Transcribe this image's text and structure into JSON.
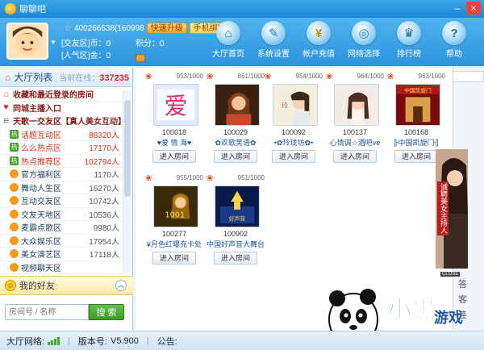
{
  "window": {
    "title": "聊聊吧"
  },
  "user": {
    "id_line": "400266638(160998",
    "quick_upgrade": "快速升级",
    "bind_phone": "手机绑定",
    "coin_label": "[交友区]币：",
    "coin_value": "0",
    "points_label": "积分：",
    "points_value": "0",
    "gold_label": "[人气区]金：",
    "gold_value": "0"
  },
  "nav": [
    {
      "label": "大厅首页",
      "icon": "home-icon"
    },
    {
      "label": "系统设置",
      "icon": "wrench-icon"
    },
    {
      "label": "帐户充值",
      "icon": "money-bag-icon"
    },
    {
      "label": "网络选择",
      "icon": "globe-icon"
    },
    {
      "label": "排行榜",
      "icon": "crown-icon"
    },
    {
      "label": "帮助",
      "icon": "help-icon"
    }
  ],
  "lobby": {
    "title": "大厅列表",
    "online_label": "当前在线：",
    "online_count": "337235",
    "rooms": [
      {
        "name": "收藏和最近登录的房间",
        "count": "",
        "icon": "home-icon"
      },
      {
        "name": "同城主播入口",
        "count": "",
        "icon": "heart-icon"
      },
      {
        "name": "天歌一交友区【真人美女互动】",
        "count": "",
        "icon": "heart-icon"
      },
      {
        "name": "话题互动区",
        "count": "88320人",
        "icon": "hot-icon"
      },
      {
        "name": "么么热点区",
        "count": "17170人",
        "icon": "hot-icon"
      },
      {
        "name": "热点推荐区",
        "count": "102794人",
        "icon": "hot-icon"
      },
      {
        "name": "官方福利区",
        "count": "1170人",
        "icon": "fire-icon"
      },
      {
        "name": "舞动人生区",
        "count": "16270人",
        "icon": "fire-icon"
      },
      {
        "name": "互动交友区",
        "count": "10742人",
        "icon": "fire-icon"
      },
      {
        "name": "交友天地区",
        "count": "10536人",
        "icon": "fire-icon"
      },
      {
        "name": "麦霸点歌区",
        "count": "9980人",
        "icon": "fire-icon"
      },
      {
        "name": "大众娱乐区",
        "count": "17954人",
        "icon": "fire-icon"
      },
      {
        "name": "美女演艺区",
        "count": "17118人",
        "icon": "fire-icon"
      },
      {
        "name": "视频聊天区",
        "count": "",
        "icon": "fire-icon"
      }
    ]
  },
  "friends": {
    "title": "我的好友"
  },
  "search": {
    "placeholder": "房间号 / 名称",
    "button": "搜 索"
  },
  "cards": [
    {
      "score": "953/1000",
      "id": "100018",
      "name": "♥爱 情 海♥",
      "enter": "进入房间"
    },
    {
      "score": "861/1000",
      "id": "100029",
      "name": "✿欢歌笑语✿",
      "enter": "进入房间"
    },
    {
      "score": "954/1000",
      "id": "100092",
      "name": "•✿玲珑坊✿•",
      "enter": "进入房间"
    },
    {
      "score": "964/1000",
      "id": "100137",
      "name": "心情调☆酒吧ve",
      "enter": "进入房间"
    },
    {
      "score": "963/1000",
      "id": "100168",
      "name": "╠中国凯旋门╣",
      "enter": "进入房间"
    },
    {
      "score": "955/1000",
      "id": "100277",
      "name": "¥月色红曝充卡处",
      "enter": "进入房间"
    },
    {
      "score": "951/1000",
      "id": "100902",
      "name": "中国好声音大舞台",
      "enter": "进入房间"
    }
  ],
  "ad": {
    "text": "诚聘美女主持人",
    "close": "CLOSE"
  },
  "side_chars": [
    "答",
    "客",
    "诖"
  ],
  "status": {
    "network_label": "大厅网络:",
    "version_label": "版本号:",
    "version": "V5.900",
    "notice_label": "公告:"
  }
}
